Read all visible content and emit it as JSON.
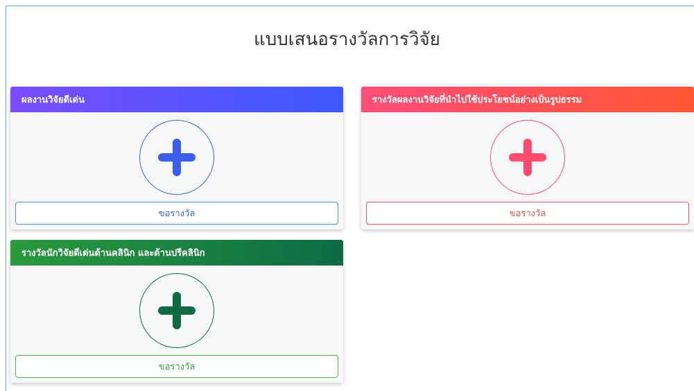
{
  "page": {
    "title": "แบบเสนอรางวัลการวิจัย"
  },
  "cards": [
    {
      "header": "ผลงานวิจัยดีเด่น",
      "button_label": "ขอรางวัล",
      "icon": "plus-circle-icon",
      "colors": {
        "header_from": "#7a4dff",
        "header_to": "#3c5afd",
        "accent": "#3b5ef0",
        "button_text": "#3a66c4",
        "button_border": "#4a8fe0"
      }
    },
    {
      "header": "รางวัลผลงานวิจัยที่นำไปใช้ประโยชน์อย่างเป็นรูปธรรม",
      "button_label": "ขอรางวัล",
      "icon": "plus-circle-icon",
      "colors": {
        "header_from": "#ff4d7a",
        "header_to": "#ff5533",
        "accent": "#ff4a6e",
        "button_text": "#d9534f",
        "button_border": "#e05a5a"
      }
    },
    {
      "header": "รางวัลนักวิจัยดีเด่นด้านคลินิก และด้านปรีคลินิก",
      "button_label": "ขอรางวัล",
      "icon": "plus-circle-icon",
      "colors": {
        "header_from": "#2a9a3e",
        "header_to": "#0d6b45",
        "accent": "#0f6a45",
        "button_text": "#3a9a4a",
        "button_border": "#4caf50"
      }
    }
  ]
}
